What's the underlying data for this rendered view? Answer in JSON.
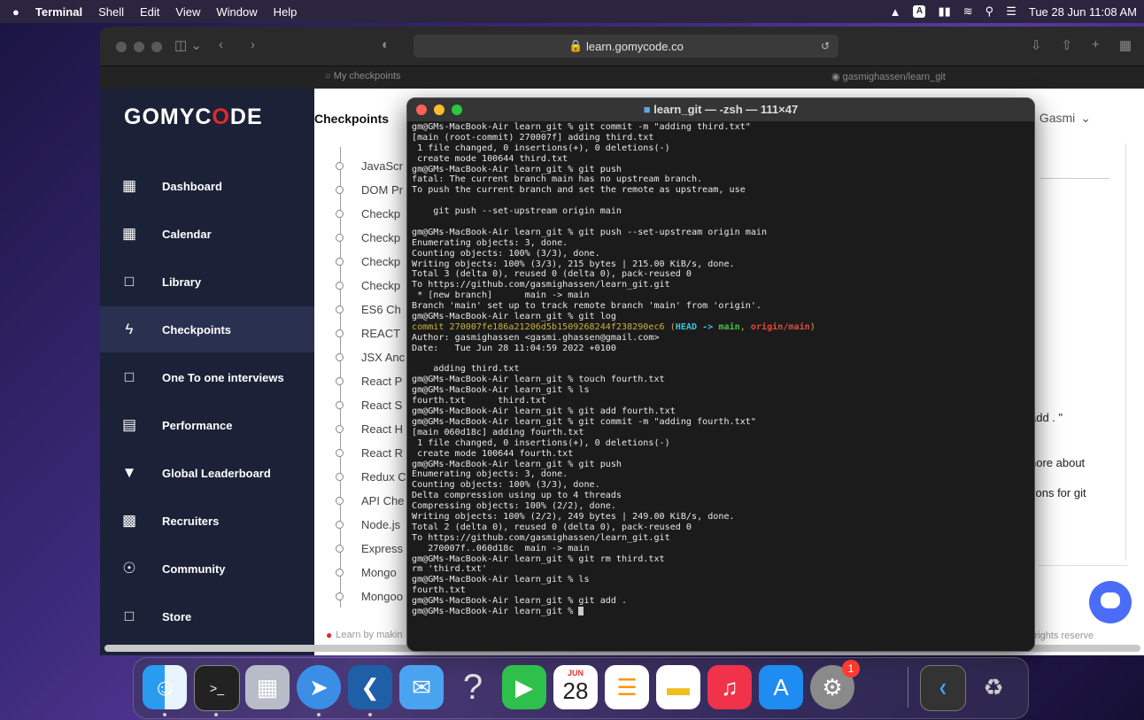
{
  "menubar": {
    "apple": "",
    "app": "Terminal",
    "items": [
      "Shell",
      "Edit",
      "View",
      "Window",
      "Help"
    ],
    "clock": "Tue 28 Jun  11:08 AM",
    "input_badge": "A"
  },
  "safari": {
    "url": "learn.gomycode.co",
    "tabs": [
      "My checkpoints",
      "gasmighassen/learn_git"
    ]
  },
  "app": {
    "logo": "GOMYCODE",
    "page_title": "Checkpoints",
    "user_name": "Gasmi",
    "nav": [
      {
        "label": "Dashboard",
        "icon": "dashboard-icon"
      },
      {
        "label": "Calendar",
        "icon": "calendar-icon"
      },
      {
        "label": "Library",
        "icon": "library-icon"
      },
      {
        "label": "Checkpoints",
        "icon": "checkpoints-icon",
        "active": true
      },
      {
        "label": "One To one interviews",
        "icon": "chat-icon"
      },
      {
        "label": "Performance",
        "icon": "performance-icon"
      },
      {
        "label": "Global Leaderboard",
        "icon": "trophy-icon"
      },
      {
        "label": "Recruiters",
        "icon": "recruiters-icon"
      },
      {
        "label": "Community",
        "icon": "globe-icon"
      },
      {
        "label": "Store",
        "icon": "cart-icon"
      }
    ],
    "checkpoints": [
      "JavaScr",
      "DOM Pr",
      "Checkp",
      "Checkp",
      "Checkp",
      "Checkp",
      "ES6 Ch",
      "REACT ",
      "JSX Anc",
      "React P",
      "React S",
      "React H",
      "React R",
      "Redux C",
      "API Che",
      "Node.js",
      "Express",
      "Mongo",
      "Mongoo"
    ],
    "side_texts": [
      "add . \"",
      "nore about",
      "tions for git"
    ],
    "footer": "Learn by makin",
    "footer_right": "l rights reserve"
  },
  "terminal": {
    "title": "learn_git — -zsh — 111×47",
    "lines": [
      {
        "t": "gm@GMs-MacBook-Air learn_git % git commit -m \"adding third.txt\""
      },
      {
        "t": "[main (root-commit) 270007f] adding third.txt"
      },
      {
        "t": " 1 file changed, 0 insertions(+), 0 deletions(-)"
      },
      {
        "t": " create mode 100644 third.txt"
      },
      {
        "t": "gm@GMs-MacBook-Air learn_git % git push"
      },
      {
        "t": "fatal: The current branch main has no upstream branch."
      },
      {
        "t": "To push the current branch and set the remote as upstream, use"
      },
      {
        "t": ""
      },
      {
        "t": "    git push --set-upstream origin main"
      },
      {
        "t": ""
      },
      {
        "t": "gm@GMs-MacBook-Air learn_git % git push --set-upstream origin main"
      },
      {
        "t": "Enumerating objects: 3, done."
      },
      {
        "t": "Counting objects: 100% (3/3), done."
      },
      {
        "t": "Writing objects: 100% (3/3), 215 bytes | 215.00 KiB/s, done."
      },
      {
        "t": "Total 3 (delta 0), reused 0 (delta 0), pack-reused 0"
      },
      {
        "t": "To https://github.com/gasmighassen/learn_git.git"
      },
      {
        "t": " * [new branch]      main -> main"
      },
      {
        "t": "Branch 'main' set up to track remote branch 'main' from 'origin'."
      },
      {
        "t": "gm@GMs-MacBook-Air learn_git % git log"
      },
      {
        "commit": "commit 270007fe186a21206d5b1509268244f238290ec6",
        "head": "HEAD -> ",
        "branch": "main",
        "sep": ", ",
        "origin": "origin/main"
      },
      {
        "t": "Author: gasmighassen <gasmi.ghassen@gmail.com>"
      },
      {
        "t": "Date:   Tue Jun 28 11:04:59 2022 +0100"
      },
      {
        "t": ""
      },
      {
        "t": "    adding third.txt"
      },
      {
        "t": "gm@GMs-MacBook-Air learn_git % touch fourth.txt"
      },
      {
        "t": "gm@GMs-MacBook-Air learn_git % ls"
      },
      {
        "t": "fourth.txt      third.txt"
      },
      {
        "t": "gm@GMs-MacBook-Air learn_git % git add fourth.txt"
      },
      {
        "t": "gm@GMs-MacBook-Air learn_git % git commit -m \"adding fourth.txt\""
      },
      {
        "t": "[main 060d18c] adding fourth.txt"
      },
      {
        "t": " 1 file changed, 0 insertions(+), 0 deletions(-)"
      },
      {
        "t": " create mode 100644 fourth.txt"
      },
      {
        "t": "gm@GMs-MacBook-Air learn_git % git push"
      },
      {
        "t": "Enumerating objects: 3, done."
      },
      {
        "t": "Counting objects: 100% (3/3), done."
      },
      {
        "t": "Delta compression using up to 4 threads"
      },
      {
        "t": "Compressing objects: 100% (2/2), done."
      },
      {
        "t": "Writing objects: 100% (2/2), 249 bytes | 249.00 KiB/s, done."
      },
      {
        "t": "Total 2 (delta 0), reused 0 (delta 0), pack-reused 0"
      },
      {
        "t": "To https://github.com/gasmighassen/learn_git.git"
      },
      {
        "t": "   270007f..060d18c  main -> main"
      },
      {
        "t": "gm@GMs-MacBook-Air learn_git % git rm third.txt"
      },
      {
        "t": "rm 'third.txt'"
      },
      {
        "t": "gm@GMs-MacBook-Air learn_git % ls"
      },
      {
        "t": "fourth.txt"
      },
      {
        "t": "gm@GMs-MacBook-Air learn_git % git add ."
      },
      {
        "t": "gm@GMs-MacBook-Air learn_git % ",
        "cursor": true
      }
    ]
  },
  "dock": {
    "apps": [
      "finder-icon",
      "terminal-icon",
      "launchpad-icon",
      "safari-icon",
      "vscode-icon",
      "mail-icon",
      "help-icon",
      "facetime-icon",
      "calendar-app-icon",
      "reminders-icon",
      "notes-icon",
      "music-icon",
      "appstore-icon",
      "settings-icon"
    ],
    "calendar_month": "JUN",
    "calendar_day": "28",
    "settings_badge": "1",
    "colors": {
      "accent": "#e02a2a",
      "sidebar": "#1b2137"
    }
  }
}
